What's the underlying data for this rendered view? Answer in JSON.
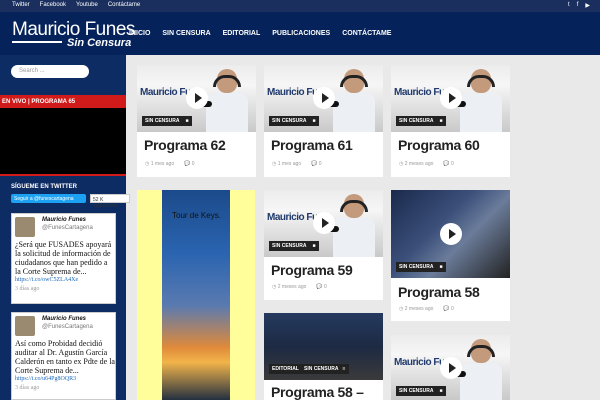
{
  "topbar": {
    "links": [
      "Twitter",
      "Facebook",
      "Youtube",
      "Contáctame"
    ],
    "social_icons": [
      "twitter-icon",
      "facebook-icon",
      "youtube-icon"
    ]
  },
  "header": {
    "logo_line1": "Mauricio Funes",
    "logo_line2": "Sin Censura",
    "nav": [
      "INICIO",
      "SIN CENSURA",
      "EDITORIAL",
      "PUBLICACIONES",
      "CONTÁCTAME"
    ]
  },
  "sidebar": {
    "search_placeholder": "Search ...",
    "live_label": "EN VIVO | PROGRAMA 65",
    "follow_title": "SÍGUEME EN TWITTER",
    "follow_button": "Seguir a @funescartagena",
    "followers": "52 K seguidores",
    "tweets": [
      {
        "name": "Mauricio Funes",
        "handle": "@FunesCartagena",
        "text": "¿Será que FUSADES apoyará la solicitud de información de ciudadanos que han pedido a la Corte Suprema de...",
        "link": "https://t.co/owC5ZLA4Xe",
        "date": "3 días ago"
      },
      {
        "name": "Mauricio Funes",
        "handle": "@FunesCartagena",
        "text": "Así como Probidad decidió auditar al Dr. Agustín García Calderón en tanto ex Pdte de la Corte Suprema de...",
        "link": "https://t.co/u64Pg8OQR3",
        "date": "3 días ago"
      }
    ]
  },
  "cards": [
    {
      "title": "Programa 62",
      "tag": "SIN CENSURA",
      "time": "1 mes ago",
      "comments": "0"
    },
    {
      "title": "Programa 61",
      "tag": "SIN CENSURA",
      "time": "1 mes ago",
      "comments": "0"
    },
    {
      "title": "Programa 60",
      "tag": "SIN CENSURA",
      "time": "2 meses ago",
      "comments": "0"
    },
    {
      "title": "Programa 59",
      "tag": "SIN CENSURA",
      "time": "2 meses ago",
      "comments": "0"
    },
    {
      "title": "Programa 58",
      "tag": "SIN CENSURA",
      "time": "2 meses ago",
      "comments": "0"
    },
    {
      "title": "Programa 58 –",
      "tag": "EDITORIAL",
      "tag2": "SIN CENSURA",
      "time": "",
      "comments": ""
    },
    {
      "title": "",
      "tag": "SIN CENSURA",
      "time": "",
      "comments": ""
    }
  ],
  "thumb_brand": "Mauricio Fu",
  "ad": {
    "caption": "Tour de Keys."
  }
}
